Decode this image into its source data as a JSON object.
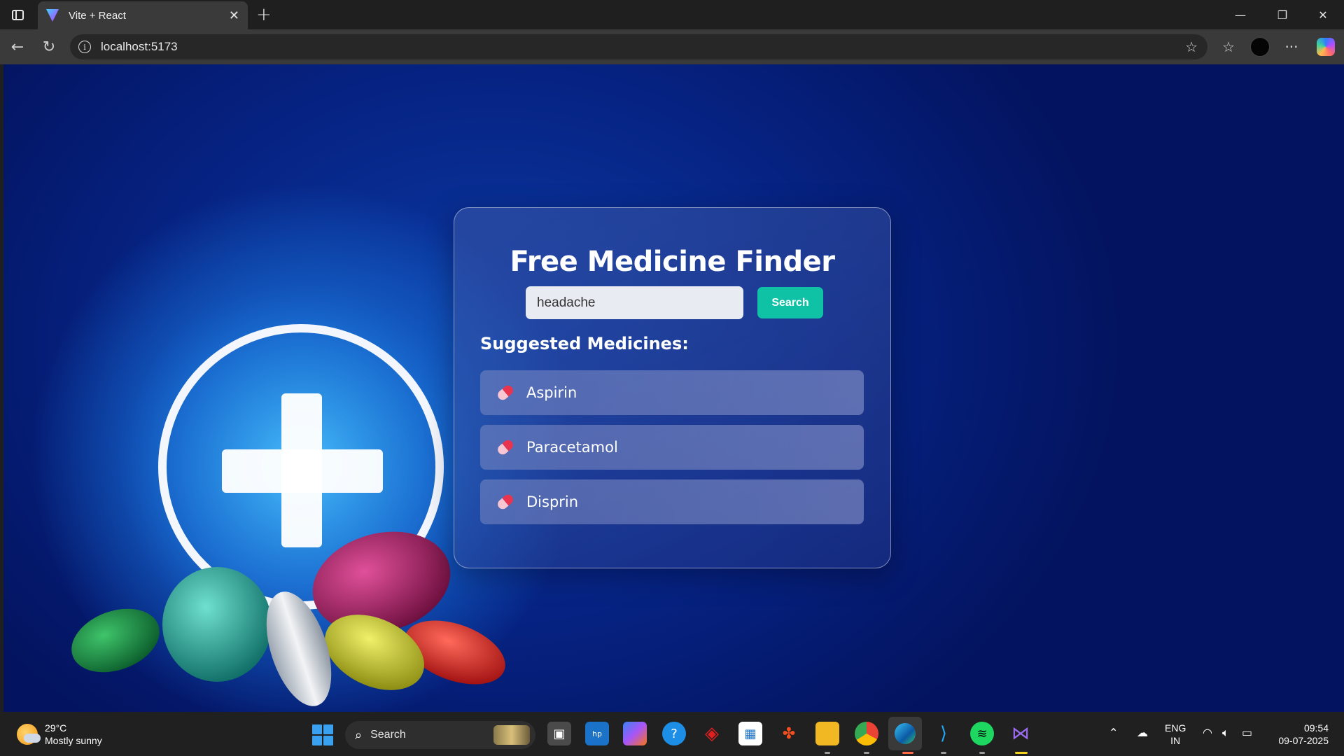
{
  "browser": {
    "tab_title": "Vite + React",
    "url": "localhost:5173"
  },
  "app": {
    "title": "Free Medicine Finder",
    "search_value": "headache",
    "search_button": "Search",
    "suggestions_heading": "Suggested Medicines:",
    "medicines": [
      {
        "name": "Aspirin",
        "icon": "pill-icon"
      },
      {
        "name": "Paracetamol",
        "icon": "pill-icon"
      },
      {
        "name": "Disprin",
        "icon": "pill-icon"
      }
    ],
    "colors": {
      "button": "#0fc2a6",
      "background": "#03135f"
    }
  },
  "taskbar": {
    "weather_temp": "29°C",
    "weather_desc": "Mostly sunny",
    "search_label": "Search",
    "language": "ENG",
    "region": "IN",
    "time": "09:54",
    "date": "09-07-2025"
  }
}
